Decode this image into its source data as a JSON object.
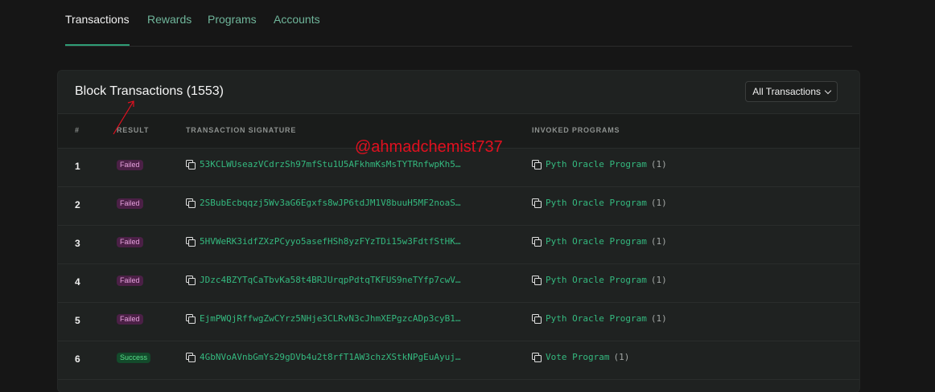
{
  "tabs": [
    {
      "label": "Transactions",
      "active": true
    },
    {
      "label": "Rewards",
      "active": false
    },
    {
      "label": "Programs",
      "active": false
    },
    {
      "label": "Accounts",
      "active": false
    }
  ],
  "card": {
    "title": "Block Transactions (1553)",
    "filter_label": "All Transactions"
  },
  "table": {
    "headers": {
      "num": "#",
      "result": "RESULT",
      "signature": "TRANSACTION SIGNATURE",
      "programs": "INVOKED PROGRAMS"
    },
    "rows": [
      {
        "num": "1",
        "result": "Failed",
        "signature": "53KCLWUseazVCdrzSh97mfStu1U5AFkhmKsMsTYTRnfwpKh5…",
        "program": "Pyth Oracle Program",
        "count": "(1)"
      },
      {
        "num": "2",
        "result": "Failed",
        "signature": "2SBubEcbqqzj5Wv3aG6Egxfs8wJP6tdJM1V8buuH5MF2noaS…",
        "program": "Pyth Oracle Program",
        "count": "(1)"
      },
      {
        "num": "3",
        "result": "Failed",
        "signature": "5HVWeRK3idfZXzPCyyo5asefHSh8yzFYzTDi15w3FdtfStHK…",
        "program": "Pyth Oracle Program",
        "count": "(1)"
      },
      {
        "num": "4",
        "result": "Failed",
        "signature": "JDzc4BZYTqCaTbvKa58t4BRJUrqpPdtqTKFUS9neTYfp7cwV…",
        "program": "Pyth Oracle Program",
        "count": "(1)"
      },
      {
        "num": "5",
        "result": "Failed",
        "signature": "EjmPWQjRffwgZwCYrz5NHje3CLRvN3cJhmXEPgzcADp3cyB1…",
        "program": "Pyth Oracle Program",
        "count": "(1)"
      },
      {
        "num": "6",
        "result": "Success",
        "signature": "4GbNVoAVnbGmYs29gDVb4u2t8rfT1AW3chzXStkNPgEuAyuj…",
        "program": "Vote Program",
        "count": "(1)"
      }
    ]
  },
  "watermark": "@ahmadchemist737",
  "colors": {
    "accent": "#2f9d76",
    "link": "#34b97f",
    "failed": "#e7a2de",
    "success": "#58e08a",
    "watermark": "#e0101f"
  }
}
